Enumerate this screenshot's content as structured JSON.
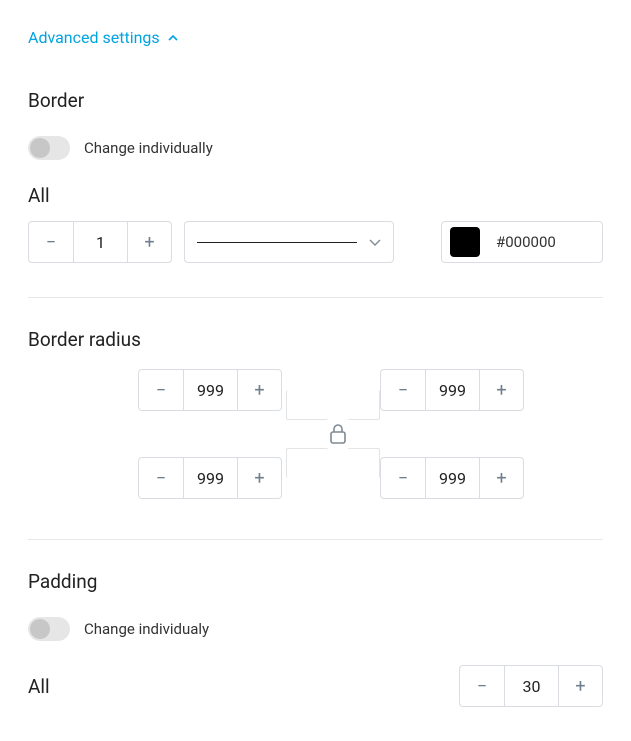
{
  "advanced": {
    "label": "Advanced settings"
  },
  "border": {
    "title": "Border",
    "toggle_label": "Change individually",
    "all_label": "All",
    "width": "1",
    "color_hex": "#000000",
    "swatch": "#000000"
  },
  "radius": {
    "title": "Border radius",
    "tl": "999",
    "tr": "999",
    "bl": "999",
    "br": "999"
  },
  "padding": {
    "title": "Padding",
    "toggle_label": "Change individualy",
    "all_label": "All",
    "value": "30"
  },
  "glyph": {
    "minus": "−",
    "plus": "+"
  }
}
